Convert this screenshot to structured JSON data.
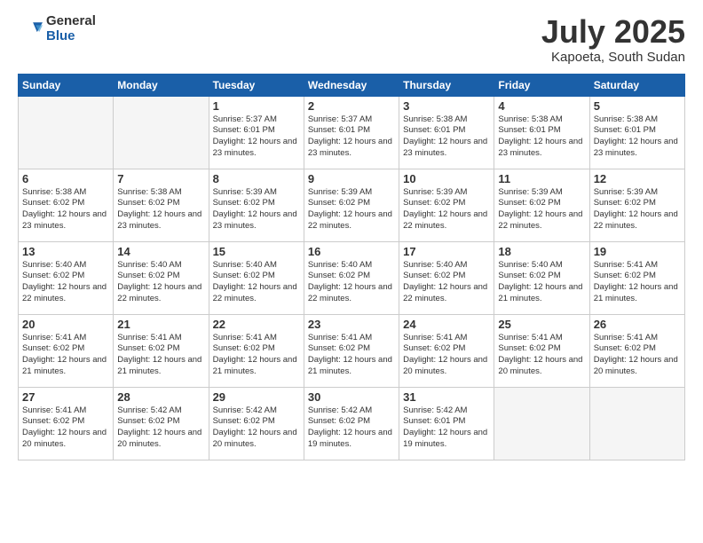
{
  "logo": {
    "general": "General",
    "blue": "Blue"
  },
  "title": "July 2025",
  "location": "Kapoeta, South Sudan",
  "weekdays": [
    "Sunday",
    "Monday",
    "Tuesday",
    "Wednesday",
    "Thursday",
    "Friday",
    "Saturday"
  ],
  "weeks": [
    [
      {
        "day": null
      },
      {
        "day": null
      },
      {
        "day": "1",
        "sunrise": "5:37 AM",
        "sunset": "6:01 PM",
        "daylight": "12 hours and 23 minutes."
      },
      {
        "day": "2",
        "sunrise": "5:37 AM",
        "sunset": "6:01 PM",
        "daylight": "12 hours and 23 minutes."
      },
      {
        "day": "3",
        "sunrise": "5:38 AM",
        "sunset": "6:01 PM",
        "daylight": "12 hours and 23 minutes."
      },
      {
        "day": "4",
        "sunrise": "5:38 AM",
        "sunset": "6:01 PM",
        "daylight": "12 hours and 23 minutes."
      },
      {
        "day": "5",
        "sunrise": "5:38 AM",
        "sunset": "6:01 PM",
        "daylight": "12 hours and 23 minutes."
      }
    ],
    [
      {
        "day": "6",
        "sunrise": "5:38 AM",
        "sunset": "6:02 PM",
        "daylight": "12 hours and 23 minutes."
      },
      {
        "day": "7",
        "sunrise": "5:38 AM",
        "sunset": "6:02 PM",
        "daylight": "12 hours and 23 minutes."
      },
      {
        "day": "8",
        "sunrise": "5:39 AM",
        "sunset": "6:02 PM",
        "daylight": "12 hours and 23 minutes."
      },
      {
        "day": "9",
        "sunrise": "5:39 AM",
        "sunset": "6:02 PM",
        "daylight": "12 hours and 22 minutes."
      },
      {
        "day": "10",
        "sunrise": "5:39 AM",
        "sunset": "6:02 PM",
        "daylight": "12 hours and 22 minutes."
      },
      {
        "day": "11",
        "sunrise": "5:39 AM",
        "sunset": "6:02 PM",
        "daylight": "12 hours and 22 minutes."
      },
      {
        "day": "12",
        "sunrise": "5:39 AM",
        "sunset": "6:02 PM",
        "daylight": "12 hours and 22 minutes."
      }
    ],
    [
      {
        "day": "13",
        "sunrise": "5:40 AM",
        "sunset": "6:02 PM",
        "daylight": "12 hours and 22 minutes."
      },
      {
        "day": "14",
        "sunrise": "5:40 AM",
        "sunset": "6:02 PM",
        "daylight": "12 hours and 22 minutes."
      },
      {
        "day": "15",
        "sunrise": "5:40 AM",
        "sunset": "6:02 PM",
        "daylight": "12 hours and 22 minutes."
      },
      {
        "day": "16",
        "sunrise": "5:40 AM",
        "sunset": "6:02 PM",
        "daylight": "12 hours and 22 minutes."
      },
      {
        "day": "17",
        "sunrise": "5:40 AM",
        "sunset": "6:02 PM",
        "daylight": "12 hours and 22 minutes."
      },
      {
        "day": "18",
        "sunrise": "5:40 AM",
        "sunset": "6:02 PM",
        "daylight": "12 hours and 21 minutes."
      },
      {
        "day": "19",
        "sunrise": "5:41 AM",
        "sunset": "6:02 PM",
        "daylight": "12 hours and 21 minutes."
      }
    ],
    [
      {
        "day": "20",
        "sunrise": "5:41 AM",
        "sunset": "6:02 PM",
        "daylight": "12 hours and 21 minutes."
      },
      {
        "day": "21",
        "sunrise": "5:41 AM",
        "sunset": "6:02 PM",
        "daylight": "12 hours and 21 minutes."
      },
      {
        "day": "22",
        "sunrise": "5:41 AM",
        "sunset": "6:02 PM",
        "daylight": "12 hours and 21 minutes."
      },
      {
        "day": "23",
        "sunrise": "5:41 AM",
        "sunset": "6:02 PM",
        "daylight": "12 hours and 21 minutes."
      },
      {
        "day": "24",
        "sunrise": "5:41 AM",
        "sunset": "6:02 PM",
        "daylight": "12 hours and 20 minutes."
      },
      {
        "day": "25",
        "sunrise": "5:41 AM",
        "sunset": "6:02 PM",
        "daylight": "12 hours and 20 minutes."
      },
      {
        "day": "26",
        "sunrise": "5:41 AM",
        "sunset": "6:02 PM",
        "daylight": "12 hours and 20 minutes."
      }
    ],
    [
      {
        "day": "27",
        "sunrise": "5:41 AM",
        "sunset": "6:02 PM",
        "daylight": "12 hours and 20 minutes."
      },
      {
        "day": "28",
        "sunrise": "5:42 AM",
        "sunset": "6:02 PM",
        "daylight": "12 hours and 20 minutes."
      },
      {
        "day": "29",
        "sunrise": "5:42 AM",
        "sunset": "6:02 PM",
        "daylight": "12 hours and 20 minutes."
      },
      {
        "day": "30",
        "sunrise": "5:42 AM",
        "sunset": "6:02 PM",
        "daylight": "12 hours and 19 minutes."
      },
      {
        "day": "31",
        "sunrise": "5:42 AM",
        "sunset": "6:01 PM",
        "daylight": "12 hours and 19 minutes."
      },
      {
        "day": null
      },
      {
        "day": null
      }
    ]
  ]
}
